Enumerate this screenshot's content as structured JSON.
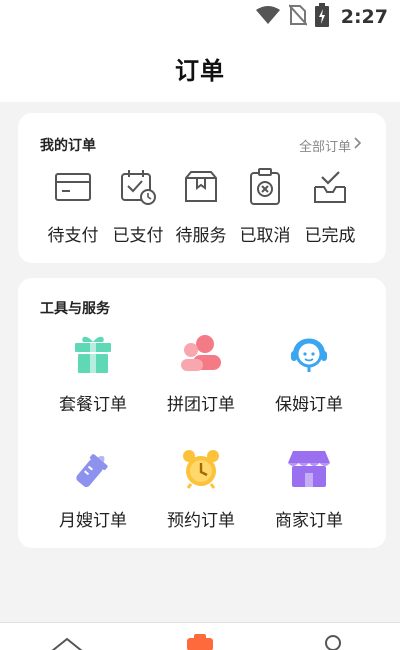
{
  "status_bar": {
    "time": "2:27",
    "icons": [
      "wifi-icon",
      "no-sim-icon",
      "battery-charging-icon"
    ]
  },
  "header": {
    "title": "订单"
  },
  "my_orders": {
    "label": "我的订单",
    "all_label": "全部订单",
    "items": [
      {
        "label": "待支付",
        "icon": "card-icon"
      },
      {
        "label": "已支付",
        "icon": "calendar-clock-icon"
      },
      {
        "label": "待服务",
        "icon": "box-icon"
      },
      {
        "label": "已取消",
        "icon": "cancelled-icon"
      },
      {
        "label": "已完成",
        "icon": "inbox-check-icon"
      }
    ]
  },
  "tools": {
    "label": "工具与服务",
    "items": [
      {
        "label": "套餐订单",
        "icon": "gift-icon",
        "color": "#5fd8b6"
      },
      {
        "label": "拼团订单",
        "icon": "group-icon",
        "color": "#f47a85"
      },
      {
        "label": "保姆订单",
        "icon": "nanny-icon",
        "color": "#3aa5f0"
      },
      {
        "label": "月嫂订单",
        "icon": "bottle-icon",
        "color": "#8d92ee"
      },
      {
        "label": "预约订单",
        "icon": "alarm-clock-icon",
        "color": "#fcc23a"
      },
      {
        "label": "商家订单",
        "icon": "shop-icon",
        "color": "#9a6ff0"
      }
    ]
  },
  "bottom_nav": {
    "tabs": [
      {
        "icon": "home-icon"
      },
      {
        "icon": "orders-icon",
        "active": true,
        "color": "#ff6a3d"
      },
      {
        "icon": "user-icon"
      }
    ]
  }
}
